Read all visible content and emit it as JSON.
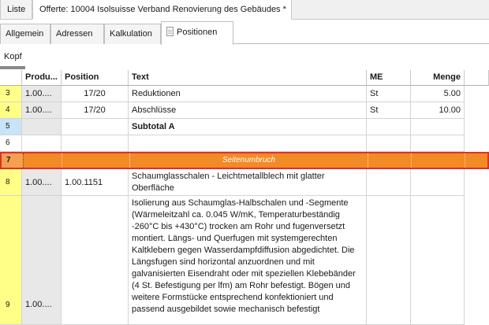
{
  "doc_tabs": [
    {
      "label": "Liste"
    },
    {
      "label": "Offerte: 10004 Isolsuisse Verband Renovierung des Gebäudes *"
    }
  ],
  "sub_tabs": [
    {
      "label": "Allgemein"
    },
    {
      "label": "Adressen"
    },
    {
      "label": "Kalkulation"
    },
    {
      "label": "Positionen"
    }
  ],
  "section_label": "Kopf",
  "columns": {
    "produkt": "Produ...",
    "position": "Position",
    "text": "Text",
    "me": "ME",
    "menge": "Menge"
  },
  "rows": [
    {
      "num": "3",
      "produkt": "1.00....",
      "position": "17/20",
      "text": "Reduktionen",
      "me": "St",
      "menge": "5.00"
    },
    {
      "num": "4",
      "produkt": "1.00....",
      "position": "17/20",
      "text": "Abschlüsse",
      "me": "St",
      "menge": "10.00"
    },
    {
      "num": "5",
      "produkt": "",
      "position": "",
      "text": "Subtotal A",
      "me": "",
      "menge": ""
    },
    {
      "num": "6",
      "produkt": "",
      "position": "",
      "text": "",
      "me": "",
      "menge": ""
    },
    {
      "num": "7",
      "text": "Seitenumbruch"
    },
    {
      "num": "8",
      "produkt": "1.00....",
      "position": "1.00.1151",
      "text": "Schaumglasschalen - Leichtmetallblech mit glatter Oberfläche",
      "me": "",
      "menge": ""
    },
    {
      "num": "9",
      "produkt": "1.00....",
      "position": "",
      "text": "Isolierung aus Schaumglas-Halbschalen und -Segmente (Wärmeleitzahl ca. 0.045 W/mK, Temperaturbeständig -260°C bis +430°C) trocken am Rohr und fugenversetzt montiert. Längs- und Querfugen mit systemgerechten Kaltklebern gegen Wasserdampfdiffusion abgedichtet. Die Längsfugen sind horizontal anzuordnen und mit galvanisierten Eisendraht oder mit speziellen Klebebänder (4 St. Befestigung per lfm) am Rohr befestigt. Bögen und weitere Formstücke entsprechend konfektioniert und passend ausgebildet sowie mechanisch befestigt",
      "me": "",
      "menge": ""
    }
  ]
}
